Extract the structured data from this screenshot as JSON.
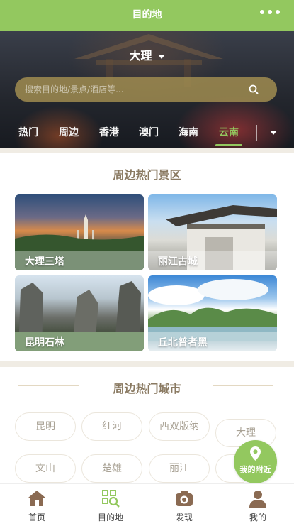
{
  "header": {
    "title": "目的地",
    "more_icon": "more-dots-icon",
    "background_color": "#93c85f"
  },
  "city_selector": {
    "value": "大理"
  },
  "search": {
    "placeholder": "搜索目的地/景点/酒店等..."
  },
  "tabs": [
    {
      "label": "热门"
    },
    {
      "label": "周边"
    },
    {
      "label": "香港"
    },
    {
      "label": "澳门"
    },
    {
      "label": "海南"
    },
    {
      "label": "云南",
      "active": true
    }
  ],
  "spots": {
    "title": "周边热门景区",
    "items": [
      {
        "label": "大理三塔"
      },
      {
        "label": "丽江古城"
      },
      {
        "label": "昆明石林"
      },
      {
        "label": "丘北普者黑"
      }
    ]
  },
  "cities": {
    "title": "周边热门城市",
    "items": [
      "昆明",
      "红河",
      "西双版纳",
      "大理",
      "文山",
      "楚雄",
      "丽江"
    ]
  },
  "nearby_button": {
    "label": "我的附近"
  },
  "nav": [
    {
      "label": "首页",
      "icon": "home-icon"
    },
    {
      "label": "目的地",
      "icon": "destination-icon",
      "active": true
    },
    {
      "label": "发现",
      "icon": "camera-icon"
    },
    {
      "label": "我的",
      "icon": "user-icon"
    }
  ],
  "colors": {
    "accent": "#93c85f",
    "muted_text": "#aaa396",
    "section_title": "#8a7a62"
  }
}
